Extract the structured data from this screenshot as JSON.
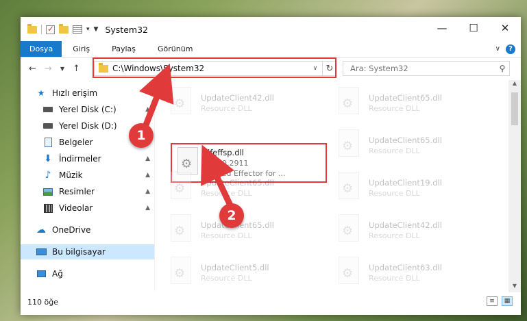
{
  "window": {
    "title": "System32"
  },
  "ribbon": {
    "tabs": [
      "Dosya",
      "Giriş",
      "Paylaş",
      "Görünüm"
    ]
  },
  "address": {
    "path": "C:\\Windows\\System32"
  },
  "search": {
    "placeholder": "Ara: System32"
  },
  "sidebar": {
    "quick_access": "Hızlı erişim",
    "items": [
      {
        "label": "Yerel Disk (C:)",
        "icon": "drive-icon",
        "pinned": true
      },
      {
        "label": "Yerel Disk (D:)",
        "icon": "drive-icon",
        "pinned": false
      },
      {
        "label": "Belgeler",
        "icon": "documents-icon",
        "pinned": true
      },
      {
        "label": "İndirmeler",
        "icon": "downloads-icon",
        "pinned": true
      },
      {
        "label": "Müzik",
        "icon": "music-icon",
        "pinned": true
      },
      {
        "label": "Resimler",
        "icon": "pictures-icon",
        "pinned": true
      },
      {
        "label": "Videolar",
        "icon": "videos-icon",
        "pinned": true
      }
    ],
    "onedrive": "OneDrive",
    "this_pc": "Bu bilgisayar",
    "network": "Ağ"
  },
  "files": [
    {
      "name": "UpdateClient42.dll",
      "desc": "Resource DLL"
    },
    {
      "name": "UpdateClient65.dll",
      "desc": "Resource DLL"
    },
    {
      "name": "jfeffsp.dll",
      "version": "6.0.0.2911",
      "desc": "Speed Effector for ..."
    },
    {
      "name": "UpdateClient65.dll",
      "desc": "Resource DLL"
    },
    {
      "name": "UpdateClient65.dll",
      "desc": "Resource DLL"
    },
    {
      "name": "UpdateClient19.dll",
      "desc": "Resource DLL"
    },
    {
      "name": "UpdateClient65.dll",
      "desc": "Resource DLL"
    },
    {
      "name": "UpdateClient42.dll",
      "desc": "Resource DLL"
    },
    {
      "name": "UpdateClient5.dll",
      "desc": "Resource DLL"
    },
    {
      "name": "UpdateClient63.dll",
      "desc": "Resource DLL"
    }
  ],
  "status": {
    "count": "110 öğe"
  },
  "annotations": {
    "step1": "1",
    "step2": "2",
    "color": "#e03a3a"
  }
}
